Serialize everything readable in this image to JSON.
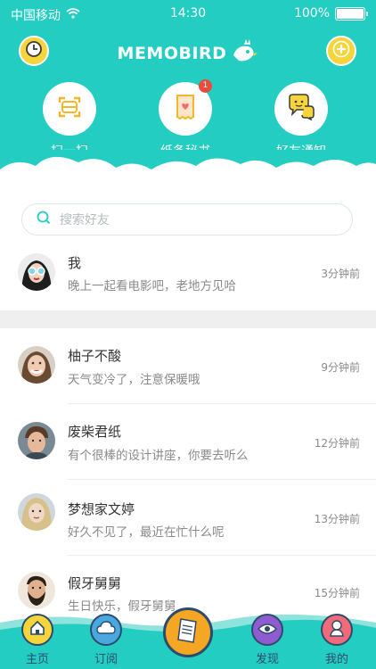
{
  "status_bar": {
    "carrier": "中国移动",
    "time": "14:30",
    "battery": "100%"
  },
  "header": {
    "logo_text": "MEMOBIRD",
    "left_button_icon": "clock-icon",
    "right_button_icon": "plus-icon",
    "features": [
      {
        "label": "扫一扫",
        "icon": "scan-icon"
      },
      {
        "label": "纸条秘书",
        "icon": "paper-heart-icon",
        "badge": "1"
      },
      {
        "label": "好友通知",
        "icon": "chat-bubble-icon"
      }
    ]
  },
  "search": {
    "placeholder": "搜索好友"
  },
  "self_row": {
    "name": "我",
    "message": "晚上一起看电影吧，老地方见哈",
    "time": "3分钟前"
  },
  "friends": [
    {
      "name": "柚子不酸",
      "message": "天气变冷了，注意保暖哦",
      "time": "9分钟前"
    },
    {
      "name": "废柴君纸",
      "message": "有个很棒的设计讲座，你要去听么",
      "time": "12分钟前"
    },
    {
      "name": "梦想家文婷",
      "message": "好久不见了，最近在忙什么呢",
      "time": "13分钟前"
    },
    {
      "name": "假牙舅舅",
      "message": "生日快乐，假牙舅舅",
      "time": "15分钟前"
    }
  ],
  "tabbar": {
    "items": [
      {
        "label": "主页",
        "icon": "home-icon",
        "color": "#f5d43c"
      },
      {
        "label": "订阅",
        "icon": "cloud-icon",
        "color": "#4aa8e0"
      },
      {
        "label": "发现",
        "icon": "eye-icon",
        "color": "#8e5bd0"
      },
      {
        "label": "我的",
        "icon": "person-icon",
        "color": "#f06b7a"
      }
    ],
    "center_icon": "paper-receipt-icon"
  },
  "colors": {
    "brand": "#23cdc2",
    "accent": "#f5d43c",
    "badge": "#e74c3c"
  }
}
